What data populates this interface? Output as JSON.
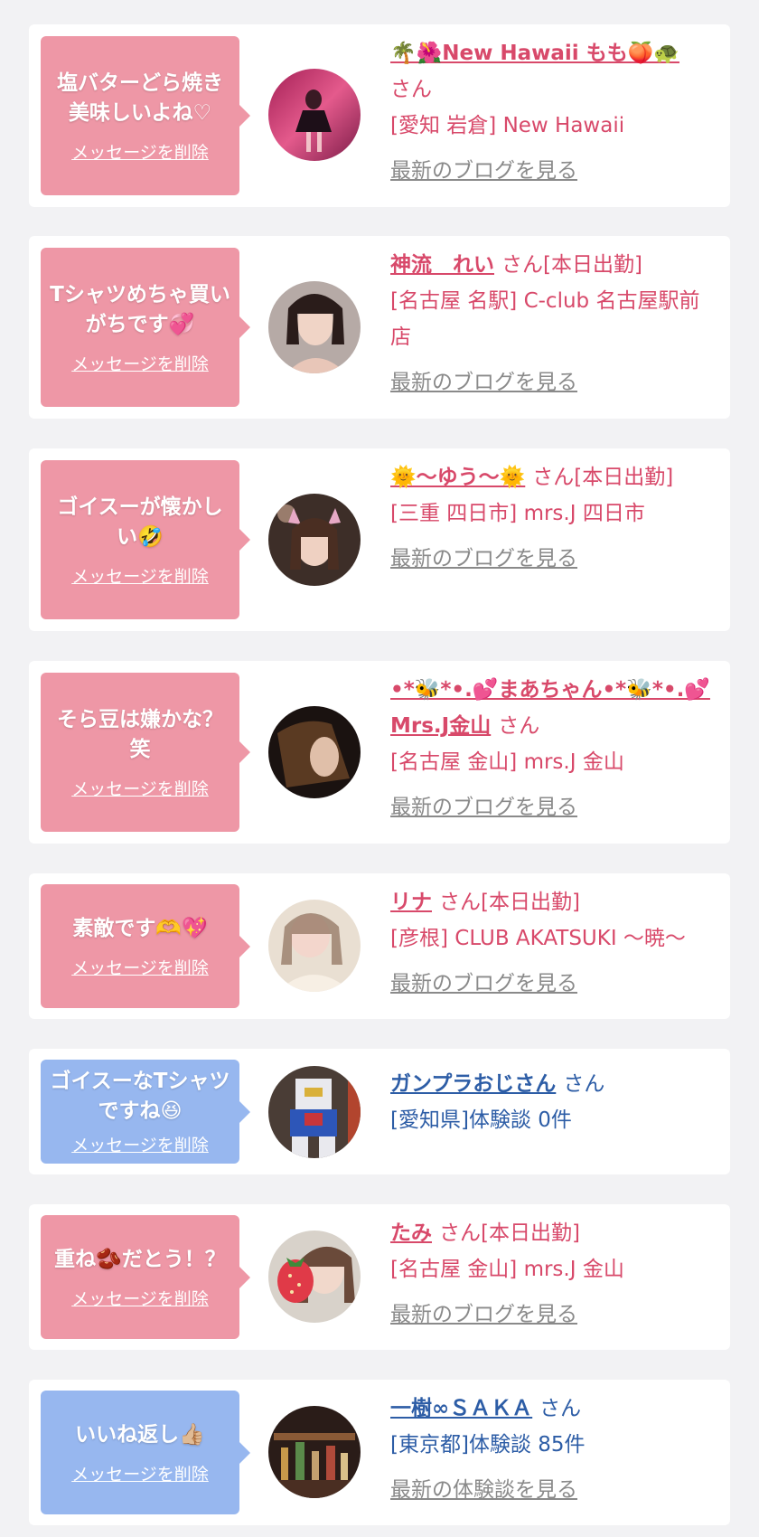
{
  "delete_label": "メッセージを削除",
  "san_label": "さん",
  "colors": {
    "pink_bubble": "#ee97a6",
    "blue_bubble": "#97b7ef",
    "pink_text": "#d8496a",
    "blue_text": "#2d5da6"
  },
  "items": [
    {
      "message": "塩バターどら焼き美味しいよね♡",
      "name": "🌴🌺New Hawaii もも🍑🐢",
      "san": "さん",
      "status": "",
      "shop": "[愛知 岩倉] New Hawaii",
      "link": "最新のブログを見る",
      "theme": "pink"
    },
    {
      "message": "Tシャツめちゃ買いがちです💞",
      "name": "神流　れい",
      "san": "さん",
      "status": "[本日出勤]",
      "shop": "[名古屋 名駅] C-club 名古屋駅前店",
      "link": "最新のブログを見る",
      "theme": "pink"
    },
    {
      "message": "ゴイスーが懐かしい🤣",
      "name": "🌞〜ゆう〜🌞",
      "san": "さん",
      "status": "[本日出勤]",
      "shop": "[三重 四日市] mrs.J 四日市",
      "link": "最新のブログを見る",
      "theme": "pink"
    },
    {
      "message": "そら豆は嫌かな？笑",
      "name": "•*🐝*•.💕まあちゃん•*🐝*•.💕Mrs.J金山",
      "san": "さん",
      "status": "",
      "shop": "[名古屋 金山] mrs.J 金山",
      "link": "最新のブログを見る",
      "theme": "pink"
    },
    {
      "message": "素敵です🫶💖",
      "name": "リナ",
      "san": "さん",
      "status": "[本日出勤]",
      "shop": "[彦根] CLUB AKATSUKI 〜暁〜",
      "link": "最新のブログを見る",
      "theme": "pink"
    },
    {
      "message": "ゴイスーなTシャツですね😆",
      "name": "ガンプラおじさん",
      "san": "さん",
      "status": "",
      "shop": "[愛知県]体験談 0件",
      "link": "",
      "theme": "blue"
    },
    {
      "message": "重ね🫘だとう！？",
      "name": "たみ",
      "san": "さん",
      "status": "[本日出勤]",
      "shop": "[名古屋 金山] mrs.J 金山",
      "link": "最新のブログを見る",
      "theme": "pink"
    },
    {
      "message": "いいね返し👍🏼",
      "name": "一樹∞ＳＡＫＡ",
      "san": "さん",
      "status": "",
      "shop": "[東京都]体験談 85件",
      "link": "最新の体験談を見る",
      "theme": "blue"
    }
  ]
}
